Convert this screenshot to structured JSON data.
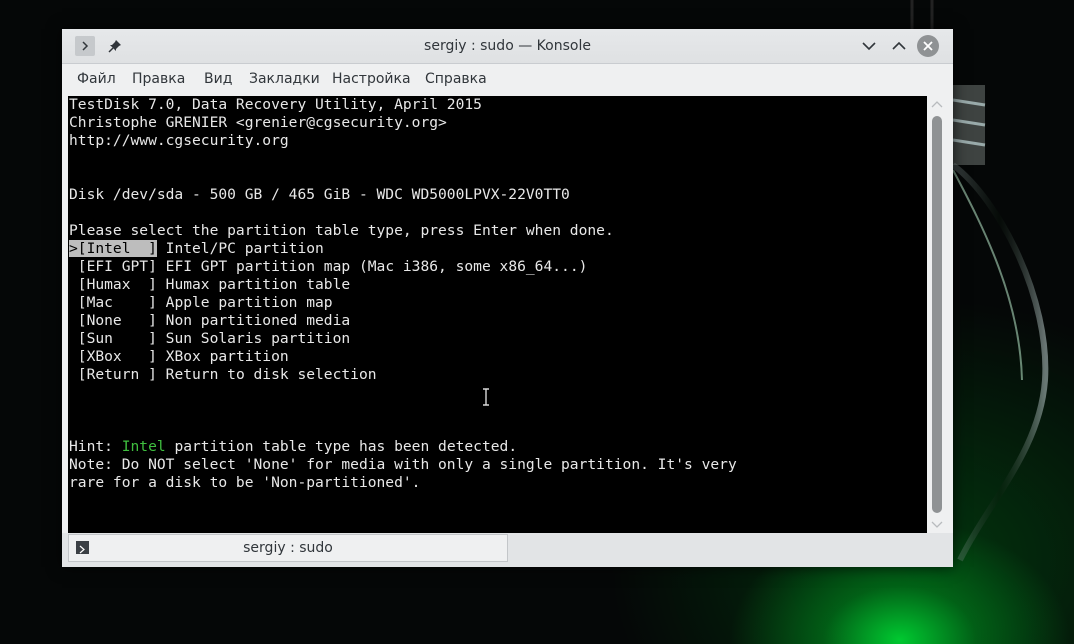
{
  "window": {
    "title": "sergiy : sudo — Konsole"
  },
  "menubar": {
    "items": [
      "Файл",
      "Правка",
      "Вид",
      "Закладки",
      "Настройка",
      "Справка"
    ]
  },
  "terminal": {
    "lines": [
      "TestDisk 7.0, Data Recovery Utility, April 2015",
      "Christophe GRENIER <grenier@cgsecurity.org>",
      "http://www.cgsecurity.org",
      "",
      "",
      "Disk /dev/sda - 500 GB / 465 GiB - WDC WD5000LPVX-22V0TT0",
      "",
      "Please select the partition table type, press Enter when done."
    ],
    "options": [
      {
        "selected": ">[Intel  ]",
        "desc": " Intel/PC partition"
      },
      {
        "selected": " [EFI GPT]",
        "desc": " EFI GPT partition map (Mac i386, some x86_64...)"
      },
      {
        "selected": " [Humax  ]",
        "desc": " Humax partition table"
      },
      {
        "selected": " [Mac    ]",
        "desc": " Apple partition map"
      },
      {
        "selected": " [None   ]",
        "desc": " Non partitioned media"
      },
      {
        "selected": " [Sun    ]",
        "desc": " Sun Solaris partition"
      },
      {
        "selected": " [XBox   ]",
        "desc": " XBox partition"
      },
      {
        "selected": " [Return ]",
        "desc": " Return to disk selection"
      }
    ],
    "hint_prefix": "Hint: ",
    "hint_word": "Intel",
    "hint_suffix": " partition table type has been detected.",
    "note_line1": "Note: Do NOT select 'None' for media with only a single partition. It's very",
    "note_line2": "rare for a disk to be 'Non-partitioned'."
  },
  "tabbar": {
    "tab_label": "sergiy : sudo"
  },
  "colors": {
    "terminal_bg": "#000000",
    "terminal_fg": "#e8e8e8",
    "selection_bg": "#bdbdbd",
    "hint_green": "#3fbf3f"
  }
}
